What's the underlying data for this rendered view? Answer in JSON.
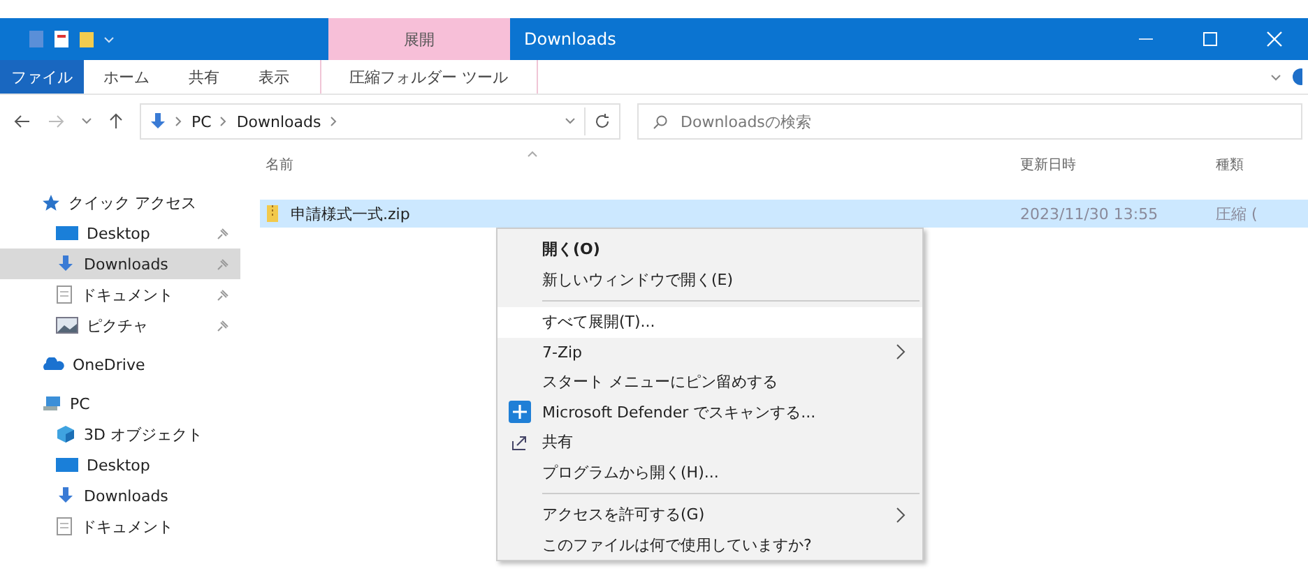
{
  "window": {
    "context_tab": "展開",
    "title": "Downloads"
  },
  "ribbon_tabs": [
    {
      "label": "ファイル",
      "kind": "file"
    },
    {
      "label": "ホーム",
      "kind": "tab"
    },
    {
      "label": "共有",
      "kind": "tab"
    },
    {
      "label": "表示",
      "kind": "tab"
    },
    {
      "label": "圧縮フォルダー ツール",
      "kind": "context"
    }
  ],
  "address": {
    "path": [
      "PC",
      "Downloads"
    ]
  },
  "search": {
    "placeholder": "Downloadsの検索"
  },
  "sidebar": {
    "items": [
      {
        "label": "クイック アクセス",
        "kind": "star",
        "selected": false,
        "children": [
          {
            "label": "Desktop",
            "kind": "desktop",
            "pinned": true,
            "selected": false
          },
          {
            "label": "Downloads",
            "kind": "download",
            "pinned": true,
            "selected": true
          },
          {
            "label": "ドキュメント",
            "kind": "document",
            "pinned": true,
            "selected": false
          },
          {
            "label": "ピクチャ",
            "kind": "picture",
            "pinned": true,
            "selected": false
          }
        ]
      },
      {
        "label": "OneDrive",
        "kind": "cloud",
        "selected": false
      },
      {
        "label": "PC",
        "kind": "pc",
        "selected": false,
        "children": [
          {
            "label": "3D オブジェクト",
            "kind": "cube",
            "pinned": false,
            "selected": false
          },
          {
            "label": "Desktop",
            "kind": "desktop",
            "pinned": false,
            "selected": false
          },
          {
            "label": "Downloads",
            "kind": "download",
            "pinned": false,
            "selected": false
          },
          {
            "label": "ドキュメント",
            "kind": "document",
            "pinned": false,
            "selected": false
          }
        ]
      }
    ]
  },
  "table": {
    "columns": [
      "名前",
      "更新日時",
      "種類"
    ],
    "rows": [
      {
        "name": "申請様式一式.zip",
        "modified": "2023/11/30 13:55",
        "type": "圧縮 (",
        "selected": true
      }
    ]
  },
  "context_menu": {
    "items": [
      {
        "kind": "item",
        "label": "開く(O)",
        "bold": true,
        "submenu": false,
        "selected": false
      },
      {
        "kind": "item",
        "label": "新しいウィンドウで開く(E)",
        "bold": false,
        "submenu": false,
        "selected": false
      },
      {
        "kind": "separator"
      },
      {
        "kind": "item",
        "label": "すべて展開(T)...",
        "bold": false,
        "submenu": false,
        "selected": true
      },
      {
        "kind": "item",
        "label": "7-Zip",
        "bold": false,
        "submenu": true,
        "selected": false
      },
      {
        "kind": "item",
        "label": "スタート メニューにピン留めする",
        "bold": false,
        "submenu": false,
        "selected": false
      },
      {
        "kind": "defender",
        "label": "Microsoft Defender でスキャンする...",
        "bold": false,
        "submenu": false,
        "selected": false
      },
      {
        "kind": "share",
        "label": "共有",
        "bold": false,
        "submenu": false,
        "selected": false
      },
      {
        "kind": "item",
        "label": "プログラムから開く(H)...",
        "bold": false,
        "submenu": false,
        "selected": false
      },
      {
        "kind": "separator"
      },
      {
        "kind": "item",
        "label": "アクセスを許可する(G)",
        "bold": false,
        "submenu": true,
        "selected": false
      },
      {
        "kind": "item",
        "label": "このファイルは何で使用していますか?",
        "bold": false,
        "submenu": false,
        "selected": false
      }
    ]
  }
}
